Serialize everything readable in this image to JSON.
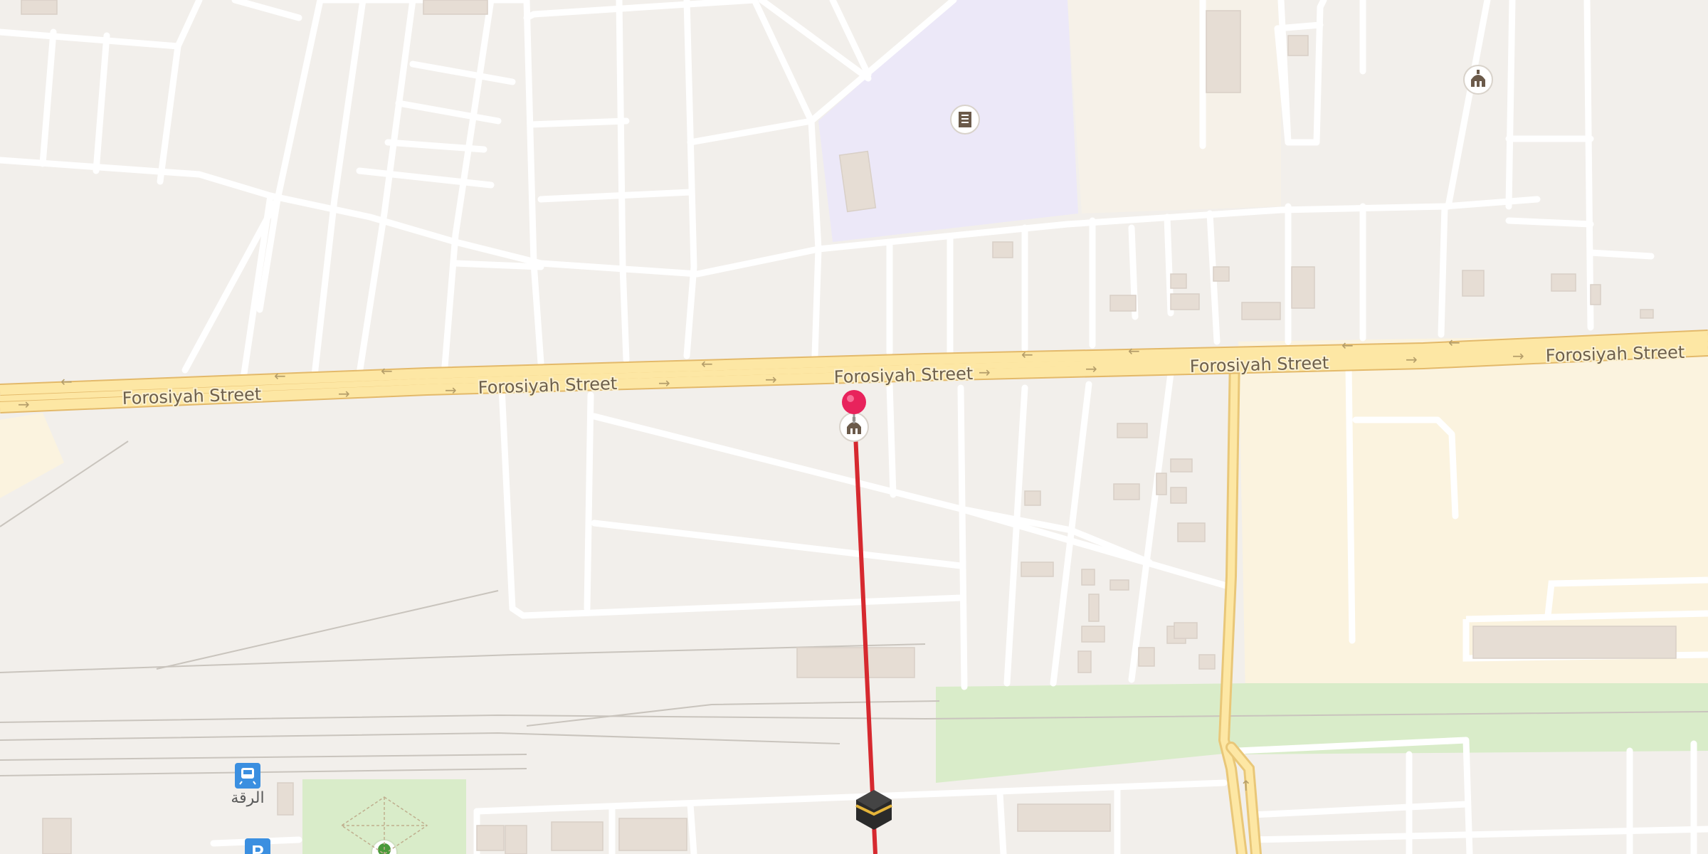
{
  "streets": {
    "main": "Forosiyah Street",
    "labels": [
      "Forosiyah Street",
      "Forosiyah Street",
      "Forosiyah Street",
      "Forosiyah Street",
      "Forosiyah Street"
    ]
  },
  "poi": {
    "station_label": "الرقة",
    "parking_letter": "P"
  },
  "icons": {
    "pin": "location-pin-icon",
    "mosque": "mosque-icon",
    "kaaba": "kaaba-icon",
    "school": "school-icon",
    "train": "train-station-icon",
    "parking": "parking-icon",
    "park": "park-icon"
  },
  "colors": {
    "background": "#f2efeb",
    "road_fill": "#fde7a4",
    "road_casing": "#e9c778",
    "minor_road": "#ffffff",
    "block": "#ebe6e0",
    "school_area": "#ece8f8",
    "green_area": "#d9ecc9",
    "commercial_area": "#fbf3df",
    "qibla_line": "#d6292f",
    "pin": "#e8235c",
    "transit_blue": "#3b8fe0"
  }
}
